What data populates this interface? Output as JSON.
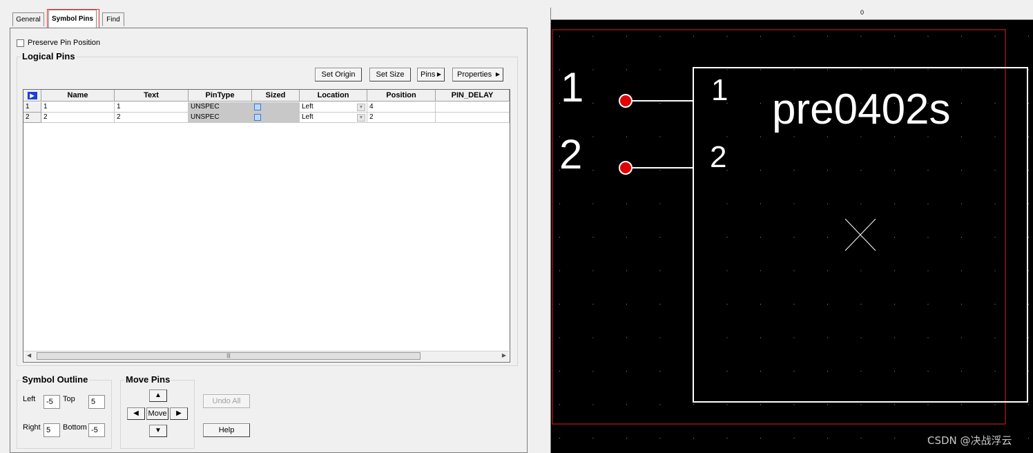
{
  "tabs": [
    {
      "label": "General"
    },
    {
      "label": "Symbol Pins"
    },
    {
      "label": "Find"
    }
  ],
  "preserve_pin_position": {
    "label": "Preserve Pin Position",
    "checked": false
  },
  "logical_pins": {
    "title": "Logical Pins",
    "buttons": {
      "set_origin": "Set Origin",
      "set_size": "Set Size",
      "pins": "Pins",
      "properties": "Properties"
    },
    "columns": [
      "Name",
      "Text",
      "PinType",
      "Sized",
      "Location",
      "Position",
      "PIN_DELAY"
    ],
    "rows": [
      {
        "num": "1",
        "name": "1",
        "text": "1",
        "pintype": "UNSPEC",
        "location": "Left",
        "position": "4",
        "pin_delay": ""
      },
      {
        "num": "2",
        "name": "2",
        "text": "2",
        "pintype": "UNSPEC",
        "location": "Left",
        "position": "2",
        "pin_delay": ""
      }
    ]
  },
  "symbol_outline": {
    "title": "Symbol Outline",
    "left_label": "Left",
    "left_value": "-5",
    "top_label": "Top",
    "top_value": "5",
    "right_label": "Right",
    "right_value": "5",
    "bottom_label": "Bottom",
    "bottom_value": "-5"
  },
  "move_pins": {
    "title": "Move Pins",
    "move_label": "Move"
  },
  "actions": {
    "undo_all": "Undo All",
    "help": "Help"
  },
  "canvas": {
    "ruler_zero": "0",
    "part_name": "pre0402s",
    "pin_numbers_outer": [
      "1",
      "2"
    ],
    "pin_numbers_inner": [
      "1",
      "2"
    ],
    "pin_dot_color": "#e00000",
    "boundary_color": "#e02020",
    "watermark": "CSDN @决战浮云"
  }
}
